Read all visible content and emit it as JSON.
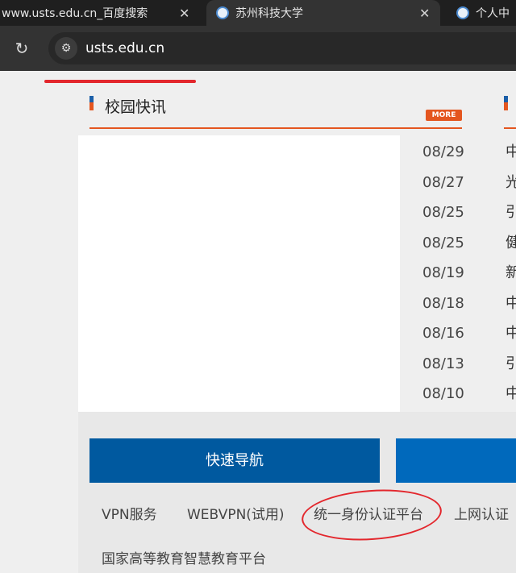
{
  "tabs": [
    {
      "title": "www.usts.edu.cn_百度搜索",
      "close": "✕"
    },
    {
      "title": "苏州科技大学",
      "close": "✕"
    },
    {
      "title": "个人中"
    }
  ],
  "toolbar": {
    "reload_icon": "↻",
    "site_info_icon": "⚙",
    "url": "usts.edu.cn"
  },
  "section": {
    "title": "校园快讯",
    "more": "MORE"
  },
  "news_dates": [
    "08/29",
    "08/27",
    "08/25",
    "08/25",
    "08/19",
    "08/18",
    "08/16",
    "08/13",
    "08/10"
  ],
  "news_chars": [
    "中",
    "光",
    "引",
    "健",
    "新",
    "中",
    "中",
    "引",
    "中"
  ],
  "quick_nav": {
    "label": "快速导航"
  },
  "links": [
    "VPN服务",
    "WEBVPN(试用)",
    "统一身份认证平台",
    "上网认证",
    "国家高等教育智慧教育平台"
  ],
  "colors": {
    "accent": "#e4561f",
    "nav_blue": "#00599f",
    "annotation_red": "#e3272d"
  }
}
